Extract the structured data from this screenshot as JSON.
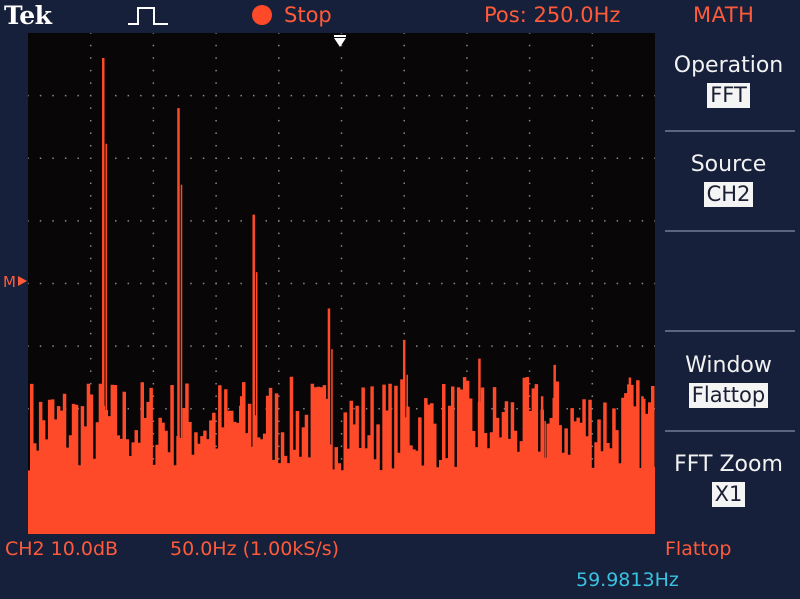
{
  "header": {
    "brand": "Tek",
    "run_state": "Stop",
    "position": "Pos: 250.0Hz",
    "menu_title": "MATH"
  },
  "menu": {
    "operation": {
      "label": "Operation",
      "value": "FFT"
    },
    "source": {
      "label": "Source",
      "value": "CH2"
    },
    "window": {
      "label": "Window",
      "value": "Flattop"
    },
    "fft_zoom": {
      "label": "FFT Zoom",
      "value": "X1"
    }
  },
  "status": {
    "channel_scale": "CH2 10.0dB",
    "horizontal_scale": "50.0Hz (1.00kS/s)",
    "window_type": "Flattop"
  },
  "readout": {
    "frequency": "59.9813Hz"
  },
  "colors": {
    "trace": "#ff4a2a",
    "text_red": "#ff5a3a",
    "readout_cyan": "#38c2e0",
    "graticule_bg": "#080607",
    "frame_bg": "#17203a"
  },
  "icons": {
    "trigger": "pulse-trigger-icon",
    "run_state": "stop-dot-icon",
    "trigger_position": "trigger-position-arrow-icon",
    "reference": "math-reference-marker-icon"
  },
  "chart_data": {
    "type": "line",
    "x_unit": "Hz",
    "y_unit": "dB",
    "xlim": [
      0,
      500
    ],
    "ylim": [
      -80,
      0
    ],
    "x_per_div": 50,
    "y_per_div": 10,
    "divisions": {
      "x": 10,
      "y": 8
    },
    "noise_floor": [
      -70,
      -55
    ],
    "peaks": [
      {
        "x": 60,
        "y": -4
      },
      {
        "x": 120,
        "y": -12
      },
      {
        "x": 180,
        "y": -29
      },
      {
        "x": 240,
        "y": -44
      },
      {
        "x": 300,
        "y": -49
      },
      {
        "x": 360,
        "y": -52
      },
      {
        "x": 420,
        "y": -53
      },
      {
        "x": 480,
        "y": -55
      },
      {
        "x": 170,
        "y": -58
      },
      {
        "x": 350,
        "y": -56
      },
      {
        "x": 410,
        "y": -58
      },
      {
        "x": 490,
        "y": -58
      }
    ]
  }
}
